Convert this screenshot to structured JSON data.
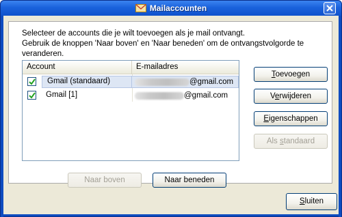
{
  "window": {
    "title": "Mailaccounten",
    "title_icon": "envelope-icon",
    "close_icon": "close-icon"
  },
  "description": {
    "line1": "Selecteer de accounts die je wilt toevoegen als je mail ontvangt.",
    "line2": "Gebruik de knoppen 'Naar boven' en 'Naar beneden' om de ontvangstvolgorde te veranderen."
  },
  "list": {
    "columns": [
      "Account",
      "E-mailadres"
    ],
    "rows": [
      {
        "checked": true,
        "account": "Gmail (standaard)",
        "email_suffix": "@gmail.com",
        "selected": true
      },
      {
        "checked": true,
        "account": "Gmail [1]",
        "email_suffix": "@gmail.com",
        "selected": false
      }
    ]
  },
  "buttons": {
    "add_ul": "T",
    "add_rest": "oevoegen",
    "del_pre": "V",
    "del_ul": "e",
    "del_rest": "rwijderen",
    "props_ul": "E",
    "props_rest": "igenschappen",
    "default_pre": "Als ",
    "default_ul": "s",
    "default_rest": "tandaard",
    "up": "Naar boven",
    "down": "Naar beneden",
    "close_ul": "S",
    "close_rest": "luiten"
  },
  "colors": {
    "titlebar": "#1a62dc",
    "dialog_bg": "#ece9d8",
    "selection": "#dde6f4"
  }
}
